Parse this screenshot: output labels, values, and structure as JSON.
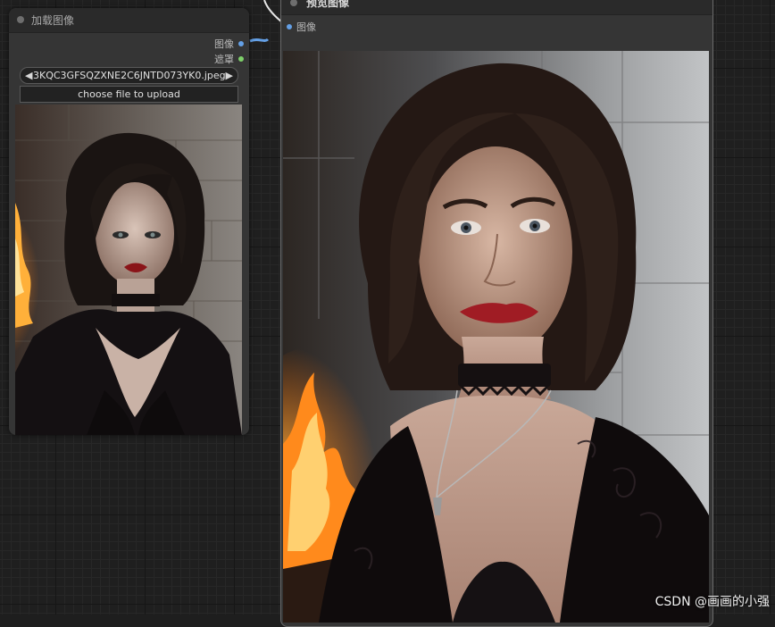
{
  "load_node": {
    "title": "加载图像",
    "outputs": [
      {
        "label": "图像",
        "color": "#64a0e6"
      },
      {
        "label": "遮罩",
        "color": "#7ed06a"
      }
    ],
    "file_combo": {
      "value": "3KQC3GFSQZXNE2C6JNTD073YK0.jpeg",
      "prev": "◀",
      "next": "▶"
    },
    "upload_label": "choose file to upload"
  },
  "preview_node": {
    "title": "预览图像",
    "inputs": [
      {
        "label": "图像",
        "color": "#64a0e6"
      }
    ]
  },
  "watermark": "CSDN @画画的小强",
  "colors": {
    "link": "#d8d8d8",
    "link_image": "#64a0e6"
  }
}
